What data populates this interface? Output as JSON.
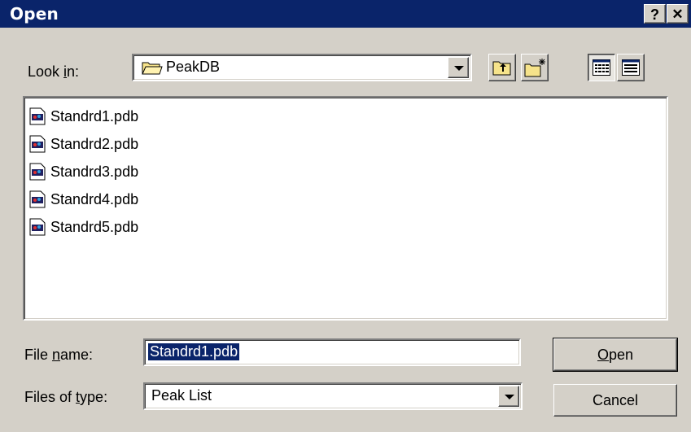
{
  "window": {
    "title": "Open",
    "help_button": "?",
    "close_button": "✕"
  },
  "look_in": {
    "label_pre": "Look ",
    "label_key": "i",
    "label_post": "n:",
    "value": "PeakDB"
  },
  "toolbar": {
    "icons": [
      "up-one-level-icon",
      "create-new-folder-icon",
      "list-view-icon",
      "details-view-icon"
    ]
  },
  "files": [
    {
      "name": "Standrd1.pdb"
    },
    {
      "name": "Standrd2.pdb"
    },
    {
      "name": "Standrd3.pdb"
    },
    {
      "name": "Standrd4.pdb"
    },
    {
      "name": "Standrd5.pdb"
    }
  ],
  "file_name": {
    "label_pre": "File ",
    "label_key": "n",
    "label_post": "ame:",
    "value": "Standrd1.pdb"
  },
  "file_type": {
    "label_pre": "Files of ",
    "label_key": "t",
    "label_post": "ype:",
    "value": "Peak List"
  },
  "buttons": {
    "open_key": "O",
    "open_rest": "pen",
    "cancel": "Cancel"
  },
  "colors": {
    "titlebar": "#0a246a",
    "dialog_face": "#d4d0c8",
    "selection": "#0a246a"
  }
}
